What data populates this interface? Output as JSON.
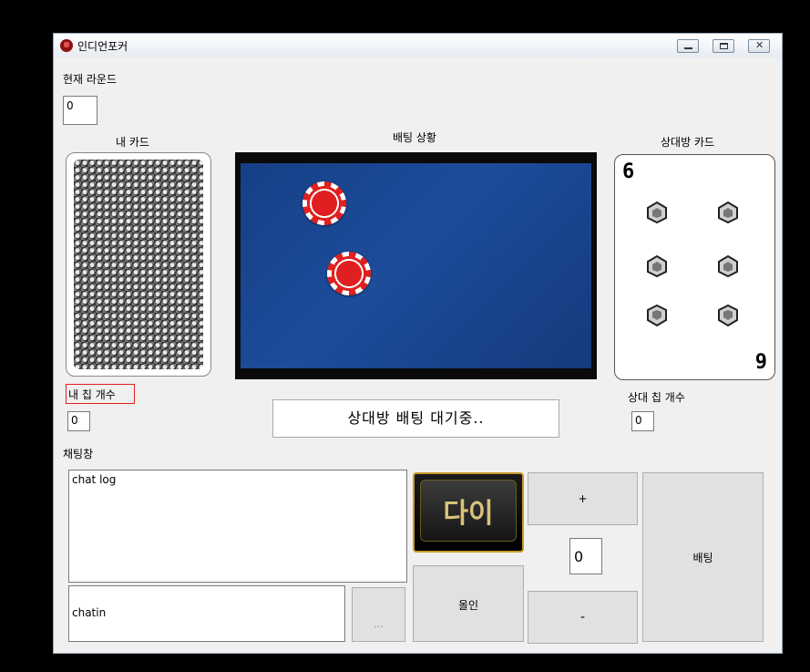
{
  "window": {
    "title": "인디언포커",
    "controls": [
      "minimize",
      "maximize",
      "close"
    ]
  },
  "round": {
    "label": "현재 라운드",
    "value": "0"
  },
  "my_card": {
    "label": "내 카드"
  },
  "betting_status": {
    "label": "배팅 상황",
    "message": "상대방 배팅 대기중.."
  },
  "opponent_card": {
    "label": "상대방 카드",
    "rank_top": "6",
    "rank_bottom": "9"
  },
  "my_chips": {
    "label": "내 칩 개수",
    "value": "0"
  },
  "opponent_chips": {
    "label": "상대 칩 개수",
    "value": "0"
  },
  "chat": {
    "label": "채팅창",
    "log": "chat log",
    "input_value": "chatin",
    "send_label": "..."
  },
  "controls": {
    "die_label": "다이",
    "allin_label": "올인",
    "plus_label": "+",
    "minus_label": "-",
    "bet_amount": "0",
    "bet_label": "배팅"
  },
  "colors": {
    "table_felt": "#1d4c9a",
    "chip_red": "#e02020",
    "highlight_outline": "#e02020",
    "die_button_border": "#c89a2a"
  }
}
